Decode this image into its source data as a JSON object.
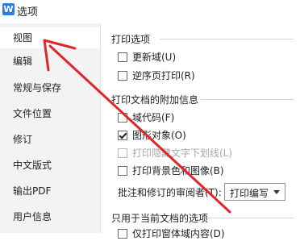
{
  "window": {
    "title": "选项",
    "app_icon_letter": "W"
  },
  "sidebar": {
    "items": [
      {
        "label": "视图",
        "selected": true
      },
      {
        "label": "编辑"
      },
      {
        "label": "常规与保存"
      },
      {
        "label": "文件位置"
      },
      {
        "label": "修订"
      },
      {
        "label": "中文版式"
      },
      {
        "label": "输出PDF"
      },
      {
        "label": "用户信息"
      }
    ]
  },
  "print_options": {
    "title": "打印选项",
    "items": [
      {
        "label": "更新域(U)",
        "checked": false
      },
      {
        "label": "逆序页打印(R)",
        "checked": false
      }
    ]
  },
  "print_extra": {
    "title": "打印文档的附加信息",
    "items": [
      {
        "label": "域代码(F)",
        "checked": false
      },
      {
        "label": "图形对象(O)",
        "checked": true
      },
      {
        "label": "打印隐藏文字下划线(L)",
        "checked": true,
        "disabled": true
      },
      {
        "label": "打印背景色和图像(B)",
        "checked": false
      }
    ],
    "reviewer_label": "批注和修订的审阅者(T):",
    "reviewer_value": "打印编写"
  },
  "current_doc": {
    "title": "只用于当前文档的选项",
    "partial_item": "仅打印窗体域内容(D)"
  },
  "annotation": {
    "arrow_color": "#e0262b"
  }
}
